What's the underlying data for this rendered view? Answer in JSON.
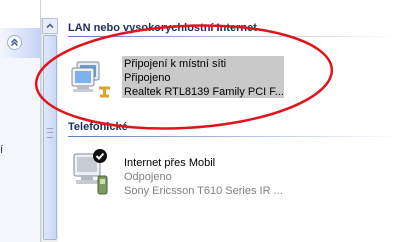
{
  "left_pane": {
    "cut_text": "í"
  },
  "groups": [
    {
      "title": "LAN nebo vysokorychlostní Internet",
      "items": [
        {
          "name": "Připojení k místní síti",
          "status": "Připojeno",
          "device": "Realtek RTL8139 Family PCI F...",
          "selected": true
        }
      ]
    },
    {
      "title": "Telefonické",
      "items": [
        {
          "name": "Internet přes Mobil",
          "status": "Odpojeno",
          "device": "Sony Ericsson T610 Series IR ...",
          "selected": false
        }
      ]
    }
  ],
  "icons": [
    "chevron-up-icon",
    "scroll-up-icon",
    "lan-connection-icon",
    "dialup-connection-icon",
    "default-check-icon",
    "phone-icon"
  ],
  "colors": {
    "annotation": "#e0141a",
    "selection": "#c9c9c9",
    "header_text": "#1b2f5c"
  }
}
